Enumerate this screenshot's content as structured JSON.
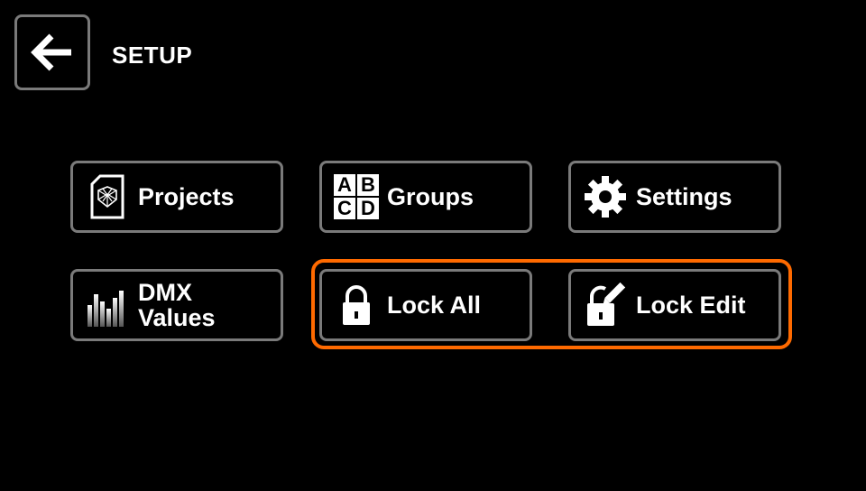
{
  "header": {
    "title": "SETUP",
    "back_icon": "arrow-left-icon"
  },
  "tiles": [
    {
      "label": "Projects",
      "icon": "project-file-icon"
    },
    {
      "label": "Groups",
      "icon": "abcd-groups-icon",
      "icon_letters": [
        "A",
        "B",
        "C",
        "D"
      ]
    },
    {
      "label": "Settings",
      "icon": "gear-icon"
    },
    {
      "label": "DMX\nValues",
      "icon": "dmx-bars-icon"
    },
    {
      "label": "Lock All",
      "icon": "lock-icon"
    },
    {
      "label": "Lock Edit",
      "icon": "lock-edit-icon"
    }
  ],
  "colors": {
    "background": "#000000",
    "border": "#7a7a7a",
    "highlight": "#ff6a00",
    "text": "#ffffff"
  }
}
